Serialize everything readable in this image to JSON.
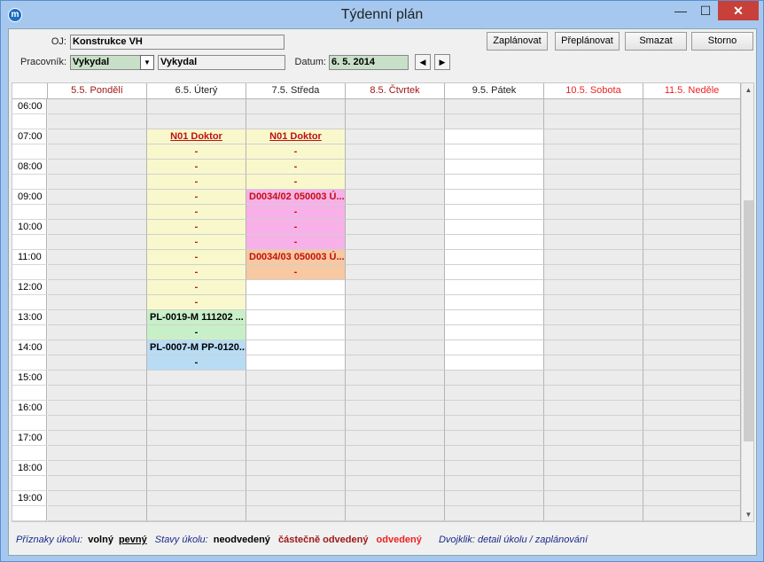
{
  "window": {
    "title": "Týdenní plán",
    "min_glyph": "—",
    "max_glyph": "☐",
    "close_glyph": "✕"
  },
  "form": {
    "oj_label": "OJ:",
    "oj_value": "Konstrukce VH",
    "worker_label": "Pracovník:",
    "worker_select": "Vykydal",
    "worker_name": "Vykydal",
    "date_label": "Datum:",
    "date_value": "6. 5. 2014"
  },
  "toolbar": {
    "plan": "Zaplánovat",
    "replan": "Přeplánovat",
    "delete": "Smazat",
    "cancel": "Storno"
  },
  "days": [
    {
      "label": "5.5. Pondělí",
      "kind": "holiday"
    },
    {
      "label": "6.5. Úterý",
      "kind": "workday"
    },
    {
      "label": "7.5. Středa",
      "kind": "workday"
    },
    {
      "label": "8.5. Čtvrtek",
      "kind": "holiday"
    },
    {
      "label": "9.5. Pátek",
      "kind": "workday"
    },
    {
      "label": "10.5. Sobota",
      "kind": "weekend"
    },
    {
      "label": "11.5. Neděle",
      "kind": "weekend"
    }
  ],
  "hours": [
    "06:00",
    "07:00",
    "08:00",
    "09:00",
    "10:00",
    "11:00",
    "12:00",
    "13:00",
    "14:00",
    "15:00",
    "16:00",
    "17:00",
    "18:00",
    "19:00"
  ],
  "slots": {
    "tue": [
      {
        "row": 2,
        "text": "N01 Doktor",
        "style": "yellow link"
      },
      {
        "row": 3,
        "text": "-",
        "style": "yellow"
      },
      {
        "row": 4,
        "text": "-",
        "style": "yellow"
      },
      {
        "row": 5,
        "text": "-",
        "style": "yellow"
      },
      {
        "row": 6,
        "text": "-",
        "style": "yellow"
      },
      {
        "row": 7,
        "text": "-",
        "style": "yellow"
      },
      {
        "row": 8,
        "text": "-",
        "style": "yellow"
      },
      {
        "row": 9,
        "text": "-",
        "style": "yellow"
      },
      {
        "row": 10,
        "text": "-",
        "style": "yellow"
      },
      {
        "row": 11,
        "text": "-",
        "style": "yellow"
      },
      {
        "row": 12,
        "text": "-",
        "style": "yellow"
      },
      {
        "row": 13,
        "text": "-",
        "style": "yellow"
      },
      {
        "row": 14,
        "text": "PL-0019-M 111202 ...",
        "style": "green left"
      },
      {
        "row": 15,
        "text": "-",
        "style": "green"
      },
      {
        "row": 16,
        "text": "PL-0007-M PP-0120...",
        "style": "blue left"
      },
      {
        "row": 17,
        "text": "-",
        "style": "blue"
      }
    ],
    "wed": [
      {
        "row": 2,
        "text": "N01 Doktor",
        "style": "yellow link"
      },
      {
        "row": 3,
        "text": "-",
        "style": "yellow"
      },
      {
        "row": 4,
        "text": "-",
        "style": "yellow"
      },
      {
        "row": 5,
        "text": "-",
        "style": "yellow"
      },
      {
        "row": 6,
        "text": "D0034/02 050003 Ú...",
        "style": "pink left"
      },
      {
        "row": 7,
        "text": "-",
        "style": "pink"
      },
      {
        "row": 8,
        "text": "-",
        "style": "pink"
      },
      {
        "row": 9,
        "text": "-",
        "style": "pink"
      },
      {
        "row": 10,
        "text": "D0034/03 050003 Ú...",
        "style": "orange left"
      },
      {
        "row": 11,
        "text": "-",
        "style": "orange"
      }
    ]
  },
  "legend": {
    "flags_label": "Příznaky úkolu:",
    "free": "volný",
    "fixed": "pevný",
    "states_label": "Stavy úkolu:",
    "undone": "neodvedený",
    "partial": "částečně odvedený",
    "done": "odvedený",
    "hint": "Dvojklik: detail úkolu / zaplánování"
  }
}
